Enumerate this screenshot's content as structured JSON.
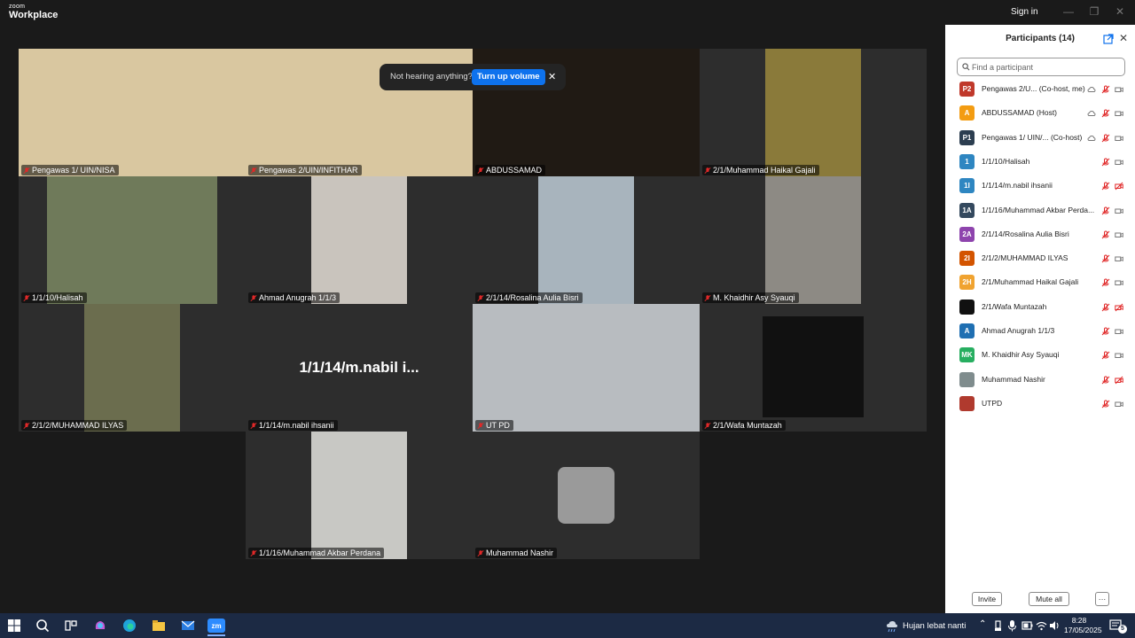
{
  "app": {
    "logo_small": "zoom",
    "logo_big": "Workplace",
    "signin": "Sign in"
  },
  "toast": {
    "message": "Not hearing anything?",
    "button": "Turn up volume"
  },
  "tiles": [
    {
      "label": "Pengawas 1/ UIN/NISA",
      "active": true
    },
    {
      "label": "Pengawas 2/UIN/INFITHAR",
      "active": false
    },
    {
      "label": "ABDUSSAMAD",
      "active": false
    },
    {
      "label": "2/1/Muhammad Haikal Gajali",
      "active": false
    },
    {
      "label": "1/1/10/Halisah",
      "active": false
    },
    {
      "label": "Ahmad Anugrah 1/1/3",
      "active": false
    },
    {
      "label": "2/1/14/Rosalina Aulia Bisri",
      "active": false
    },
    {
      "label": "M. Khaidhir Asy Syauqi",
      "active": false
    },
    {
      "label": "2/1/2/MUHAMMAD ILYAS",
      "active": false
    },
    {
      "label": "1/1/14/m.nabil ihsanii",
      "active": false,
      "big_name": "1/1/14/m.nabil  i..."
    },
    {
      "label": "UT PD",
      "active": false
    },
    {
      "label": "2/1/Wafa Muntazah",
      "active": false
    },
    {
      "label": "1/1/16/Muhammad Akbar Perdana",
      "active": false
    },
    {
      "label": "Muhammad Nashir",
      "active": false
    }
  ],
  "panel": {
    "title": "Participants (14)",
    "search_placeholder": "Find a participant",
    "invite": "Invite",
    "mute_all": "Mute all",
    "more": "···",
    "participants": [
      {
        "initials": "P2",
        "color": "#c0392b",
        "name": "Pengawas 2/U...  (Co-host, me)",
        "cloud": true,
        "video_off": false
      },
      {
        "initials": "A",
        "color": "#f39c12",
        "name": "ABDUSSAMAD (Host)",
        "cloud": true,
        "video_off": false
      },
      {
        "initials": "P1",
        "color": "#2c3e50",
        "name": "Pengawas 1/ UIN/...  (Co-host)",
        "cloud": true,
        "video_off": false
      },
      {
        "initials": "1",
        "color": "#2e86c1",
        "name": "1/1/10/Halisah",
        "cloud": false,
        "video_off": false
      },
      {
        "initials": "1I",
        "color": "#2e86c1",
        "name": "1/1/14/m.nabil ihsanii",
        "cloud": false,
        "video_off": true
      },
      {
        "initials": "1A",
        "color": "#34495e",
        "name": "1/1/16/Muhammad Akbar Perda...",
        "cloud": false,
        "video_off": false
      },
      {
        "initials": "2A",
        "color": "#8e44ad",
        "name": "2/1/14/Rosalina Aulia Bisri",
        "cloud": false,
        "video_off": false
      },
      {
        "initials": "2I",
        "color": "#d35400",
        "name": "2/1/2/MUHAMMAD ILYAS",
        "cloud": false,
        "video_off": false
      },
      {
        "initials": "2H",
        "color": "#f0a330",
        "name": "2/1/Muhammad Haikal Gajali",
        "cloud": false,
        "video_off": false
      },
      {
        "initials": "",
        "color": "#111111",
        "name": "2/1/Wafa Muntazah",
        "cloud": false,
        "video_off": true
      },
      {
        "initials": "A",
        "color": "#1f6fb2",
        "name": "Ahmad Anugrah 1/1/3",
        "cloud": false,
        "video_off": false
      },
      {
        "initials": "MK",
        "color": "#27ae60",
        "name": "M. Khaidhir Asy Syauqi",
        "cloud": false,
        "video_off": false
      },
      {
        "initials": "",
        "color": "#7f8c8d",
        "name": "Muhammad Nashir",
        "cloud": false,
        "video_off": true
      },
      {
        "initials": "",
        "color": "#b03a2e",
        "name": "UTPD",
        "cloud": false,
        "video_off": false
      }
    ]
  },
  "taskbar": {
    "weather": "Hujan lebat nanti",
    "time": "8:28",
    "date": "17/05/2025",
    "notifications": "5"
  }
}
